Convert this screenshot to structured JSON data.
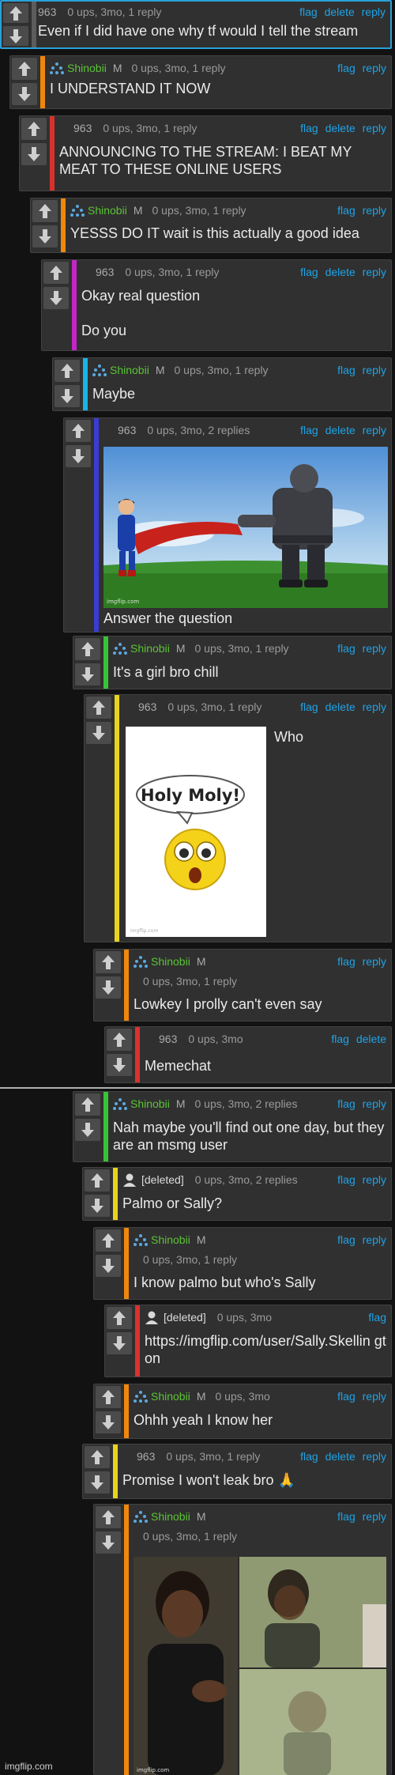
{
  "colors": {
    "accent_link": "#1fa3e6",
    "username_green": "#5bc236",
    "bar_orange": "#f0870c",
    "bar_red": "#d9322d",
    "bar_purple": "#c326c7",
    "bar_cyan": "#18b4e8",
    "bar_indigo": "#3b3bd6",
    "bar_green": "#37c437",
    "bar_yellow": "#e8d41e",
    "bar_grey": "#5c5c5c"
  },
  "icons": {
    "upvote": "arrow-up-icon",
    "downvote": "arrow-down-icon",
    "user": "user-dots-icon",
    "deleted_user": "default-avatar-icon"
  },
  "comments": [
    {
      "user": "963",
      "gender": "",
      "stats": "0 ups, 3mo, 1 reply",
      "actions": [
        "flag",
        "delete",
        "reply"
      ],
      "lines": [
        "Even if I did have one why tf would I tell the stream"
      ]
    },
    {
      "user": "Shinobii",
      "gender": "M",
      "stats": "0 ups, 3mo, 1 reply",
      "actions": [
        "flag",
        "reply"
      ],
      "lines": [
        "I UNDERSTAND IT NOW"
      ]
    },
    {
      "user": "963",
      "gender": "",
      "stats": "0 ups, 3mo, 1 reply",
      "actions": [
        "flag",
        "delete",
        "reply"
      ],
      "lines": [
        "ANNOUNCING TO THE STREAM: I BEAT MY MEAT TO THESE ONLINE USERS"
      ]
    },
    {
      "user": "Shinobii",
      "gender": "M",
      "stats": "0 ups, 3mo, 1 reply",
      "actions": [
        "flag",
        "reply"
      ],
      "lines": [
        "YESSS DO IT wait is this actually a good idea"
      ]
    },
    {
      "user": "963",
      "gender": "",
      "stats": "0 ups, 3mo, 1 reply",
      "actions": [
        "flag",
        "delete",
        "reply"
      ],
      "lines": [
        "Okay real question",
        "Do you"
      ]
    },
    {
      "user": "Shinobii",
      "gender": "M",
      "stats": "0 ups, 3mo, 1 reply",
      "actions": [
        "flag",
        "reply"
      ],
      "lines": [
        "Maybe"
      ]
    },
    {
      "user": "963",
      "gender": "",
      "stats": "0 ups, 3mo, 2 replies",
      "actions": [
        "flag",
        "delete",
        "reply"
      ],
      "lines": [
        "Answer the question"
      ],
      "image": "superman-darkseid-cape-pull"
    },
    {
      "user": "Shinobii",
      "gender": "M",
      "stats": "0 ups, 3mo, 1 reply",
      "actions": [
        "flag",
        "reply"
      ],
      "lines": [
        "It's a girl bro chill"
      ]
    },
    {
      "user": "963",
      "gender": "",
      "stats": "0 ups, 3mo, 1 reply",
      "actions": [
        "flag",
        "delete",
        "reply"
      ],
      "lines": [
        "Who"
      ],
      "image": "holy-moly-emoji",
      "image_caption": "Holy Moly!"
    },
    {
      "user": "Shinobii",
      "gender": "M",
      "stats": "0 ups, 3mo, 1 reply",
      "actions": [
        "flag",
        "reply"
      ],
      "lines": [
        "Lowkey I prolly can't even say"
      ]
    },
    {
      "user": "963",
      "gender": "",
      "stats": "0 ups, 3mo",
      "actions": [
        "flag",
        "delete"
      ],
      "lines": [
        "Memechat"
      ]
    },
    {
      "user": "Shinobii",
      "gender": "M",
      "stats": "0 ups, 3mo, 2 replies",
      "actions": [
        "flag",
        "reply"
      ],
      "lines": [
        "Nah maybe you'll find out one day, but they are an msmg user"
      ]
    },
    {
      "user": "[deleted]",
      "gender": "",
      "stats": "0 ups, 3mo, 2 replies",
      "actions": [
        "flag",
        "reply"
      ],
      "lines": [
        "Palmo or Sally?"
      ]
    },
    {
      "user": "Shinobii",
      "gender": "M",
      "stats": "0 ups, 3mo, 1 reply",
      "actions": [
        "flag",
        "reply"
      ],
      "lines": [
        "I know palmo but who's Sally"
      ]
    },
    {
      "user": "[deleted]",
      "gender": "",
      "stats": "0 ups, 3mo",
      "actions": [
        "flag"
      ],
      "lines": [
        "https://imgflip.com/user/Sally.Skellin gton"
      ]
    },
    {
      "user": "Shinobii",
      "gender": "M",
      "stats": "0 ups, 3mo",
      "actions": [
        "flag",
        "reply"
      ],
      "lines": [
        "Ohhh yeah I know her"
      ]
    },
    {
      "user": "963",
      "gender": "",
      "stats": "0 ups, 3mo, 1 reply",
      "actions": [
        "flag",
        "delete",
        "reply"
      ],
      "lines": [
        "Promise I won't leak bro 🙏"
      ]
    },
    {
      "user": "Shinobii",
      "gender": "M",
      "stats": "0 ups, 3mo, 1 reply",
      "actions": [
        "flag",
        "reply"
      ],
      "lines": [],
      "image": "man-disappearing-meme"
    }
  ],
  "image_watermark": "imgflip.com",
  "footer_watermark": "imgflip.com"
}
